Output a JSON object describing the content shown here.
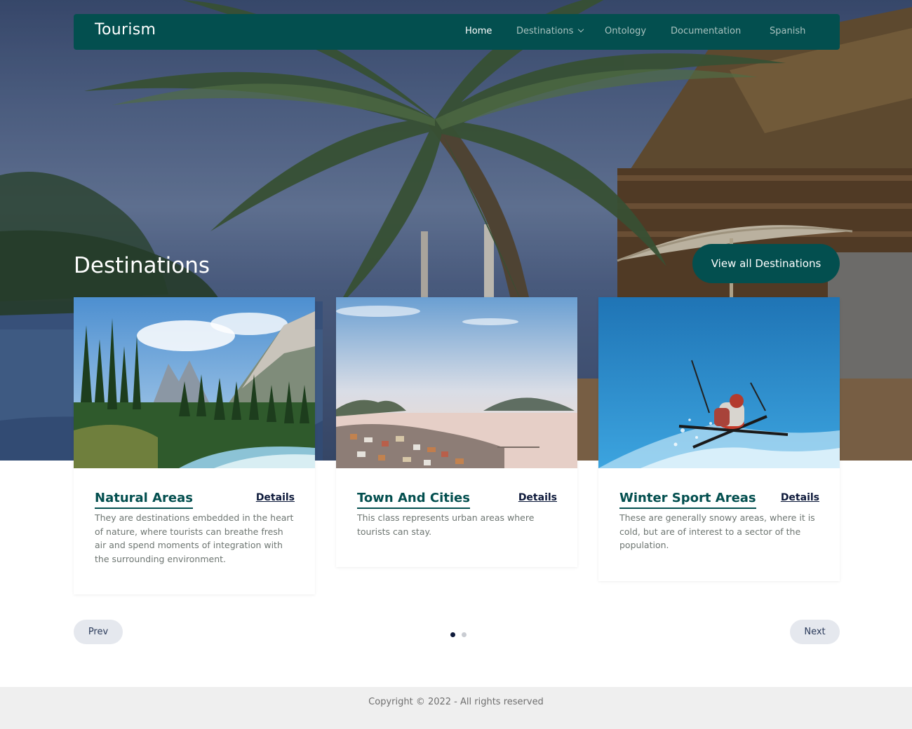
{
  "nav": {
    "brand": "Tourism",
    "items": [
      {
        "label": "Home",
        "active": true
      },
      {
        "label": "Destinations",
        "has_dropdown": true
      },
      {
        "label": "Ontology"
      },
      {
        "label": "Documentation"
      },
      {
        "label": "Spanish"
      }
    ]
  },
  "section": {
    "title": "Destinations",
    "view_all_label": "View all Destinations"
  },
  "cards": [
    {
      "title": "Natural Areas",
      "details_label": "Details",
      "description": "They are destinations embedded in the heart of nature, where tourists can breathe fresh air and spend moments of integration with the surrounding environment.",
      "image": "mountain-forest-river-photo"
    },
    {
      "title": "Town And Cities",
      "details_label": "Details",
      "description": "This class represents urban areas where tourists can stay.",
      "image": "coastal-town-sunset-photo"
    },
    {
      "title": "Winter Sport Areas",
      "details_label": "Details",
      "description": "These are generally snowy areas, where it is cold, but are of interest to a sector of the population.",
      "image": "skier-jump-photo"
    }
  ],
  "pager": {
    "prev_label": "Prev",
    "next_label": "Next",
    "pages": 2,
    "active_page": 1
  },
  "footer": {
    "copyright": "Copyright © 2022 - All rights reserved"
  },
  "colors": {
    "brand": "#034f4f",
    "details_link": "#0e1a3b",
    "dot_active": "#0e1a3b",
    "dot_inactive": "#c9ccd2",
    "footer_bg": "#efefef"
  }
}
